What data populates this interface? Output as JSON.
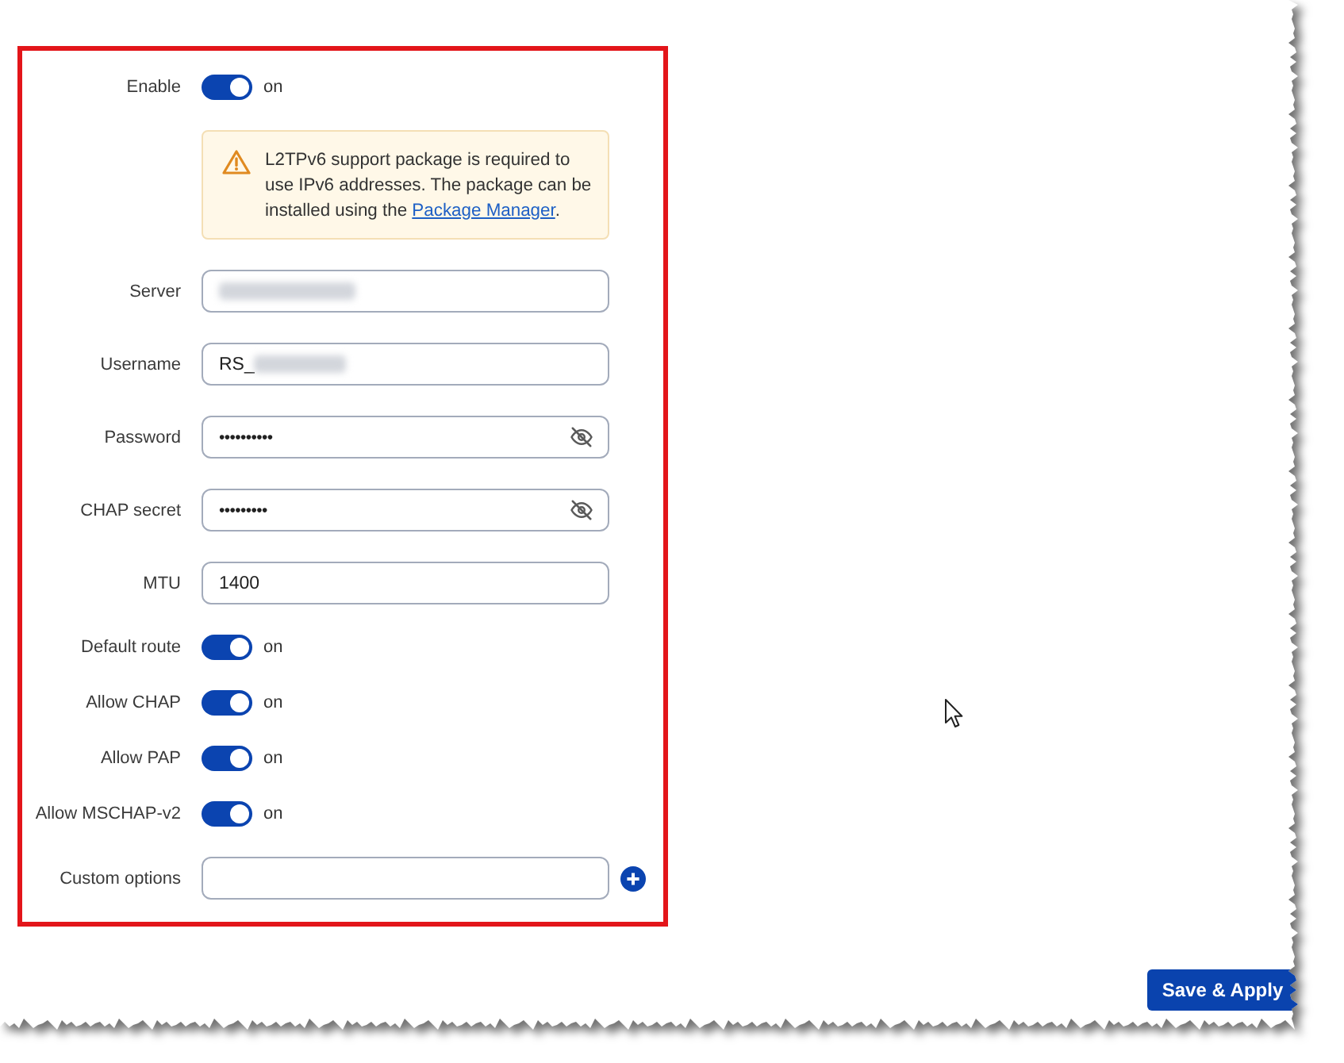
{
  "form": {
    "rows": [
      {
        "kind": "toggle",
        "label": "Enable",
        "on": true,
        "state_text": "on"
      },
      {
        "kind": "notice",
        "text": "L2TPv6 support package is required to use IPv6 addresses. The package can be installed using the",
        "link": "Package Manager",
        "text_after": "."
      },
      {
        "kind": "text",
        "label": "Server",
        "redacted": true
      },
      {
        "kind": "text",
        "label": "Username",
        "value": "RS_",
        "redacted": true
      },
      {
        "kind": "password",
        "label": "Password",
        "value": "••••••••••"
      },
      {
        "kind": "password",
        "label": "CHAP secret",
        "value": "•••••••••"
      },
      {
        "kind": "text",
        "label": "MTU",
        "value": "1400"
      },
      {
        "kind": "toggle",
        "label": "Default route",
        "on": true,
        "state_text": "on"
      },
      {
        "kind": "toggle",
        "label": "Allow CHAP",
        "on": true,
        "state_text": "on"
      },
      {
        "kind": "toggle",
        "label": "Allow PAP",
        "on": true,
        "state_text": "on"
      },
      {
        "kind": "toggle",
        "label": "Allow MSCHAP-v2",
        "on": true,
        "state_text": "on"
      },
      {
        "kind": "list",
        "label": "Custom options"
      }
    ]
  },
  "actions": {
    "save_button": "Save & Apply"
  }
}
